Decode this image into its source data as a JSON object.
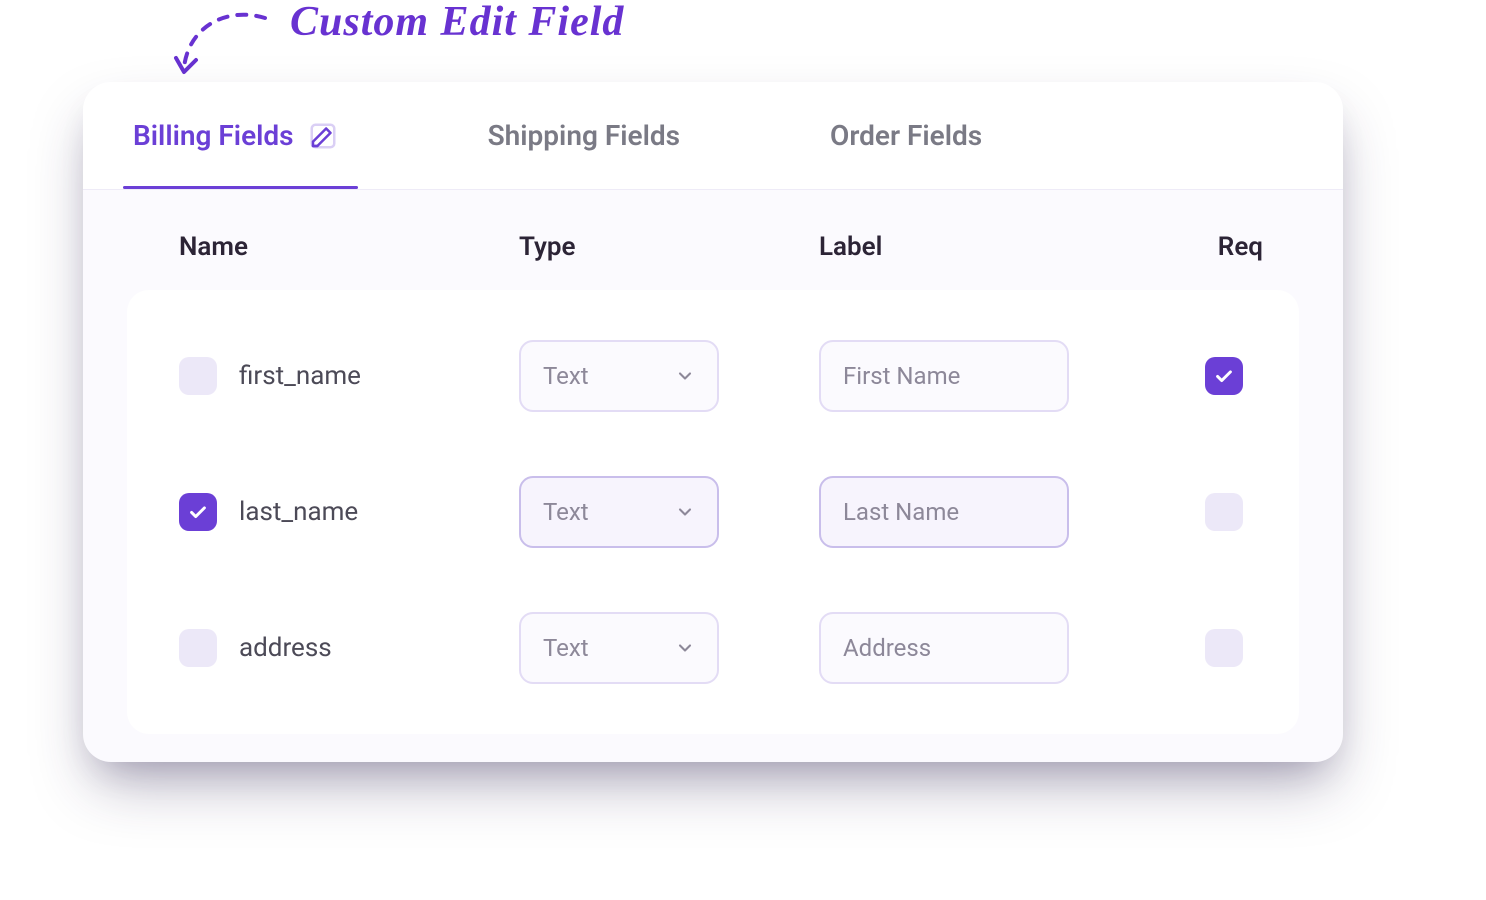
{
  "annotation": {
    "text": "Custom Edit Field"
  },
  "tabs": [
    {
      "label": "Billing Fields",
      "active": true,
      "showEdit": true
    },
    {
      "label": "Shipping Fields",
      "active": false,
      "showEdit": false
    },
    {
      "label": "Order Fields",
      "active": false,
      "showEdit": false
    }
  ],
  "columns": {
    "name": "Name",
    "type": "Type",
    "label": "Label",
    "req": "Req"
  },
  "rows": [
    {
      "selected": false,
      "name": "first_name",
      "type": "Text",
      "label": "First Name",
      "required": true,
      "focused": false
    },
    {
      "selected": true,
      "name": "last_name",
      "type": "Text",
      "label": "Last Name",
      "required": false,
      "focused": true
    },
    {
      "selected": false,
      "name": "address",
      "type": "Text",
      "label": "Address",
      "required": false,
      "focused": false
    }
  ],
  "colors": {
    "accent": "#6B3FD6",
    "muted": "#8D8899",
    "uncheckedBg": "#ECE8F8",
    "border": "#E3DCF5"
  }
}
